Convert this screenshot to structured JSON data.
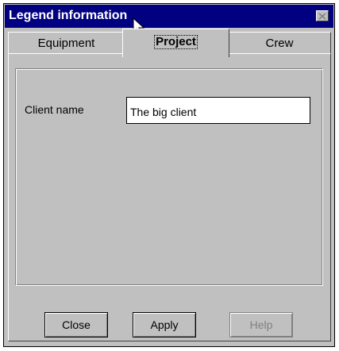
{
  "window": {
    "title": "Legend information"
  },
  "tabs": [
    {
      "label": "Equipment",
      "active": false
    },
    {
      "label": "Project",
      "active": true
    },
    {
      "label": "Crew",
      "active": false
    }
  ],
  "project": {
    "client_name_label": "Client name",
    "client_name_value": "The big client"
  },
  "buttons": {
    "close": "Close",
    "apply": "Apply",
    "help": "Help"
  },
  "colors": {
    "titlebar": "#000080",
    "face": "#c0c0c0"
  },
  "icons": {
    "title_close": "close-icon",
    "pointer": "mouse-pointer-icon"
  }
}
